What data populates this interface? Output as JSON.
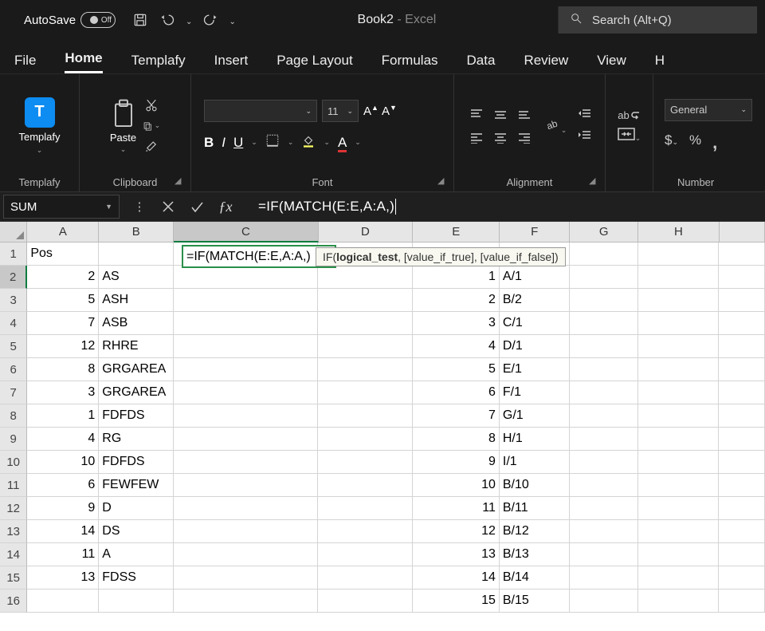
{
  "titlebar": {
    "autosave_label": "AutoSave",
    "autosave_state": "Off",
    "doc_name": "Book2",
    "app_suffix": "  -  Excel",
    "search_placeholder": "Search (Alt+Q)"
  },
  "tabs": {
    "items": [
      "File",
      "Home",
      "Templafy",
      "Insert",
      "Page Layout",
      "Formulas",
      "Data",
      "Review",
      "View",
      "H"
    ],
    "active": "Home"
  },
  "ribbon": {
    "templafy": {
      "label": "Templafy",
      "button": "Templafy",
      "glyph": "T"
    },
    "clipboard": {
      "label": "Clipboard",
      "paste": "Paste"
    },
    "font": {
      "label": "Font",
      "fontname": "",
      "fontsize": "11"
    },
    "alignment": {
      "label": "Alignment"
    },
    "wrap": {
      "label": "ab"
    },
    "number": {
      "label": "Number",
      "format": "General"
    }
  },
  "formula_bar": {
    "namebox": "SUM",
    "formula": "=IF(MATCH(E:E,A:A,)",
    "tooltip_prefix": "IF(",
    "tooltip_bold": "logical_test",
    "tooltip_rest": ", [value_if_true], [value_if_false])"
  },
  "columns": [
    "A",
    "B",
    "C",
    "D",
    "E",
    "F",
    "G",
    "H",
    ""
  ],
  "col_widths": [
    "wA",
    "wB",
    "wC",
    "wD",
    "wE",
    "wF",
    "wG",
    "wH",
    "wI"
  ],
  "rows": [
    {
      "n": 1,
      "A": "Pos",
      "B": "",
      "C": "",
      "D": "",
      "E": "",
      "F": ""
    },
    {
      "n": 2,
      "A": "2",
      "B": "AS",
      "C": "=IF(MATCH(E:E,A:A,)",
      "D": "",
      "E": "1",
      "F": "A/1"
    },
    {
      "n": 3,
      "A": "5",
      "B": "ASH",
      "C": "",
      "D": "",
      "E": "2",
      "F": "B/2"
    },
    {
      "n": 4,
      "A": "7",
      "B": "ASB",
      "C": "",
      "D": "",
      "E": "3",
      "F": "C/1"
    },
    {
      "n": 5,
      "A": "12",
      "B": "RHRE",
      "C": "",
      "D": "",
      "E": "4",
      "F": "D/1"
    },
    {
      "n": 6,
      "A": "8",
      "B": "GRGAREA",
      "C": "",
      "D": "",
      "E": "5",
      "F": "E/1"
    },
    {
      "n": 7,
      "A": "3",
      "B": "GRGAREA",
      "C": "",
      "D": "",
      "E": "6",
      "F": "F/1"
    },
    {
      "n": 8,
      "A": "1",
      "B": "FDFDS",
      "C": "",
      "D": "",
      "E": "7",
      "F": "G/1"
    },
    {
      "n": 9,
      "A": "4",
      "B": "RG",
      "C": "",
      "D": "",
      "E": "8",
      "F": "H/1"
    },
    {
      "n": 10,
      "A": "10",
      "B": "FDFDS",
      "C": "",
      "D": "",
      "E": "9",
      "F": "I/1"
    },
    {
      "n": 11,
      "A": "6",
      "B": "FEWFEW",
      "C": "",
      "D": "",
      "E": "10",
      "F": "B/10"
    },
    {
      "n": 12,
      "A": "9",
      "B": "D",
      "C": "",
      "D": "",
      "E": "11",
      "F": "B/11"
    },
    {
      "n": 13,
      "A": "14",
      "B": "DS",
      "C": "",
      "D": "",
      "E": "12",
      "F": "B/12"
    },
    {
      "n": 14,
      "A": "11",
      "B": "A",
      "C": "",
      "D": "",
      "E": "13",
      "F": "B/13"
    },
    {
      "n": 15,
      "A": "13",
      "B": "FDSS",
      "C": "",
      "D": "",
      "E": "14",
      "F": "B/14"
    },
    {
      "n": 16,
      "A": "",
      "B": "",
      "C": "",
      "D": "",
      "E": "15",
      "F": "B/15"
    }
  ]
}
